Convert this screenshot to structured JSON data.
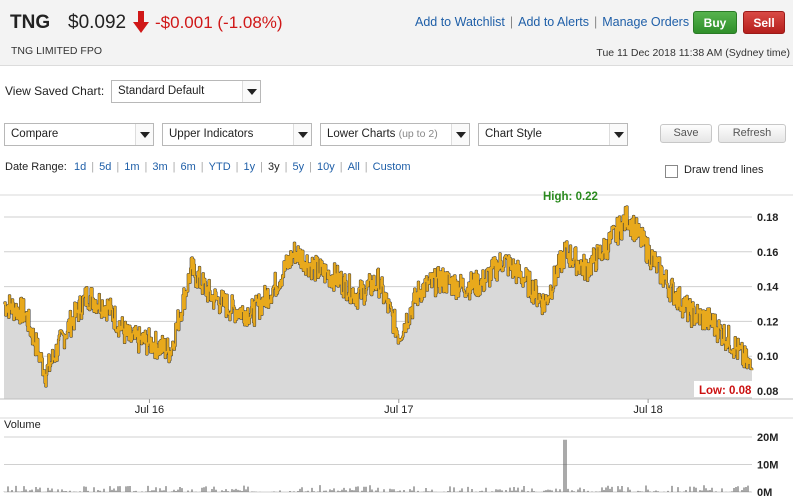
{
  "quote": {
    "ticker": "TNG",
    "price": "$0.092",
    "change": "-$0.001 (-1.08%)",
    "direction": "down",
    "company": "TNG LIMITED FPO",
    "datetime": "Tue 11 Dec 2018 11:38 AM (Sydney time)",
    "links": [
      "Add to Watchlist",
      "Add to Alerts",
      "Manage Orders"
    ],
    "buy_label": "Buy",
    "sell_label": "Sell",
    "colors": {
      "down": "#d01818",
      "buy": "#3c9b35",
      "sell": "#c8302c",
      "link": "#1f5fa8"
    }
  },
  "controls": {
    "view_saved_chart_label": "View Saved Chart:",
    "view_saved_chart_value": "Standard Default",
    "compare": "Compare",
    "upper_indicators": "Upper Indicators",
    "lower_charts": "Lower Charts",
    "lower_charts_hint": "(up to 2)",
    "chart_style": "Chart Style",
    "save_label": "Save",
    "refresh_label": "Refresh",
    "date_range_label": "Date Range:",
    "date_ranges": [
      "1d",
      "5d",
      "1m",
      "3m",
      "6m",
      "YTD",
      "1y",
      "3y",
      "5y",
      "10y",
      "All",
      "Custom"
    ],
    "active_range": "3y",
    "draw_trend_label": "Draw trend lines",
    "draw_trend_checked": false
  },
  "chart_data": {
    "type": "area",
    "price_series": {
      "name": "",
      "color": "#e8a91c",
      "fill": "#d9d9d9",
      "x": [
        "2015-12",
        "2016-01",
        "2016-02",
        "2016-03",
        "2016-04",
        "2016-05",
        "2016-06",
        "2016-07",
        "2016-08",
        "2016-09",
        "2016-10",
        "2016-11",
        "2016-12",
        "2017-01",
        "2017-02",
        "2017-03",
        "2017-04",
        "2017-05",
        "2017-06",
        "2017-07",
        "2017-08",
        "2017-09",
        "2017-10",
        "2017-11",
        "2017-12",
        "2018-01",
        "2018-02",
        "2018-03",
        "2018-04",
        "2018-05",
        "2018-06",
        "2018-07",
        "2018-08",
        "2018-09",
        "2018-10",
        "2018-11",
        "2018-12"
      ],
      "values": [
        0.13,
        0.125,
        0.09,
        0.115,
        0.135,
        0.128,
        0.11,
        0.108,
        0.103,
        0.15,
        0.134,
        0.127,
        0.125,
        0.14,
        0.16,
        0.15,
        0.145,
        0.135,
        0.143,
        0.112,
        0.138,
        0.144,
        0.14,
        0.142,
        0.155,
        0.145,
        0.13,
        0.16,
        0.15,
        0.163,
        0.18,
        0.16,
        0.14,
        0.125,
        0.12,
        0.108,
        0.092
      ]
    },
    "y_ticks": [
      "0.18",
      "0.16",
      "0.14",
      "0.12",
      "0.10",
      "0.08"
    ],
    "ylim": [
      0.08,
      0.18
    ],
    "x_ticks": [
      {
        "label": "Jul 16",
        "x": "2016-07"
      },
      {
        "label": "Jul 17",
        "x": "2017-07"
      },
      {
        "label": "Jul 18",
        "x": "2018-07"
      }
    ],
    "high_label": "High: 0.22",
    "low_label": "Low: 0.08",
    "high_color": "#2a8a1e",
    "low_color": "#cc1111",
    "grid": true,
    "volume": {
      "label": "Volume",
      "y_ticks": [
        "20M",
        "10M",
        "0M"
      ],
      "ylim": [
        0,
        20000000
      ],
      "spike": {
        "x": "2018-03",
        "value": 19000000
      },
      "typical_max": 2500000
    }
  }
}
